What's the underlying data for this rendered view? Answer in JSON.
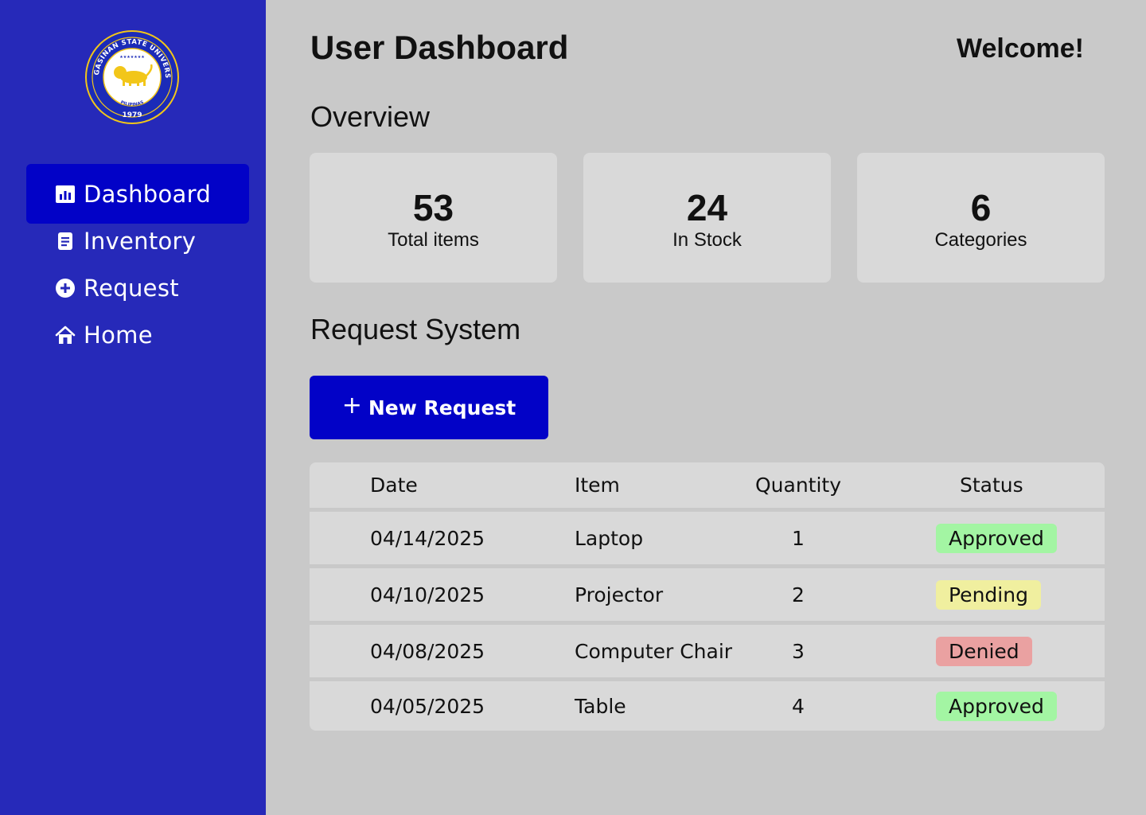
{
  "sidebar": {
    "logo": {
      "top_text": "PANGASINAN STATE UNIVERSITY",
      "bottom_text": "PILIPINAS",
      "year": "1979",
      "colors": {
        "ring": "#1b2bb8",
        "gold": "#f2c619"
      }
    },
    "items": [
      {
        "label": "Dashboard",
        "icon": "chart-icon",
        "active": true
      },
      {
        "label": "Inventory",
        "icon": "document-icon",
        "active": false
      },
      {
        "label": "Request",
        "icon": "plus-circle-icon",
        "active": false
      },
      {
        "label": "Home",
        "icon": "home-icon",
        "active": false
      }
    ]
  },
  "header": {
    "title": "User Dashboard",
    "welcome": "Welcome!"
  },
  "overview": {
    "heading": "Overview",
    "cards": [
      {
        "value": "53",
        "label": "Total items"
      },
      {
        "value": "24",
        "label": "In Stock"
      },
      {
        "value": "6",
        "label": "Categories"
      }
    ]
  },
  "requests": {
    "heading": "Request System",
    "new_button": "New Request",
    "columns": [
      "Date",
      "Item",
      "Quantity",
      "Status"
    ],
    "rows": [
      {
        "date": "04/14/2025",
        "item": "Laptop",
        "quantity": "1",
        "status": "Approved"
      },
      {
        "date": "04/10/2025",
        "item": "Projector",
        "quantity": "2",
        "status": "Pending"
      },
      {
        "date": "04/08/2025",
        "item": "Computer Chair",
        "quantity": "3",
        "status": "Denied"
      },
      {
        "date": "04/05/2025",
        "item": "Table",
        "quantity": "4",
        "status": "Approved"
      }
    ]
  },
  "colors": {
    "sidebar_bg": "#2629b9",
    "active_bg": "#0202c7",
    "approved": "#a3f5a3",
    "pending": "#f0ef9f",
    "denied": "#eaa1a1"
  }
}
